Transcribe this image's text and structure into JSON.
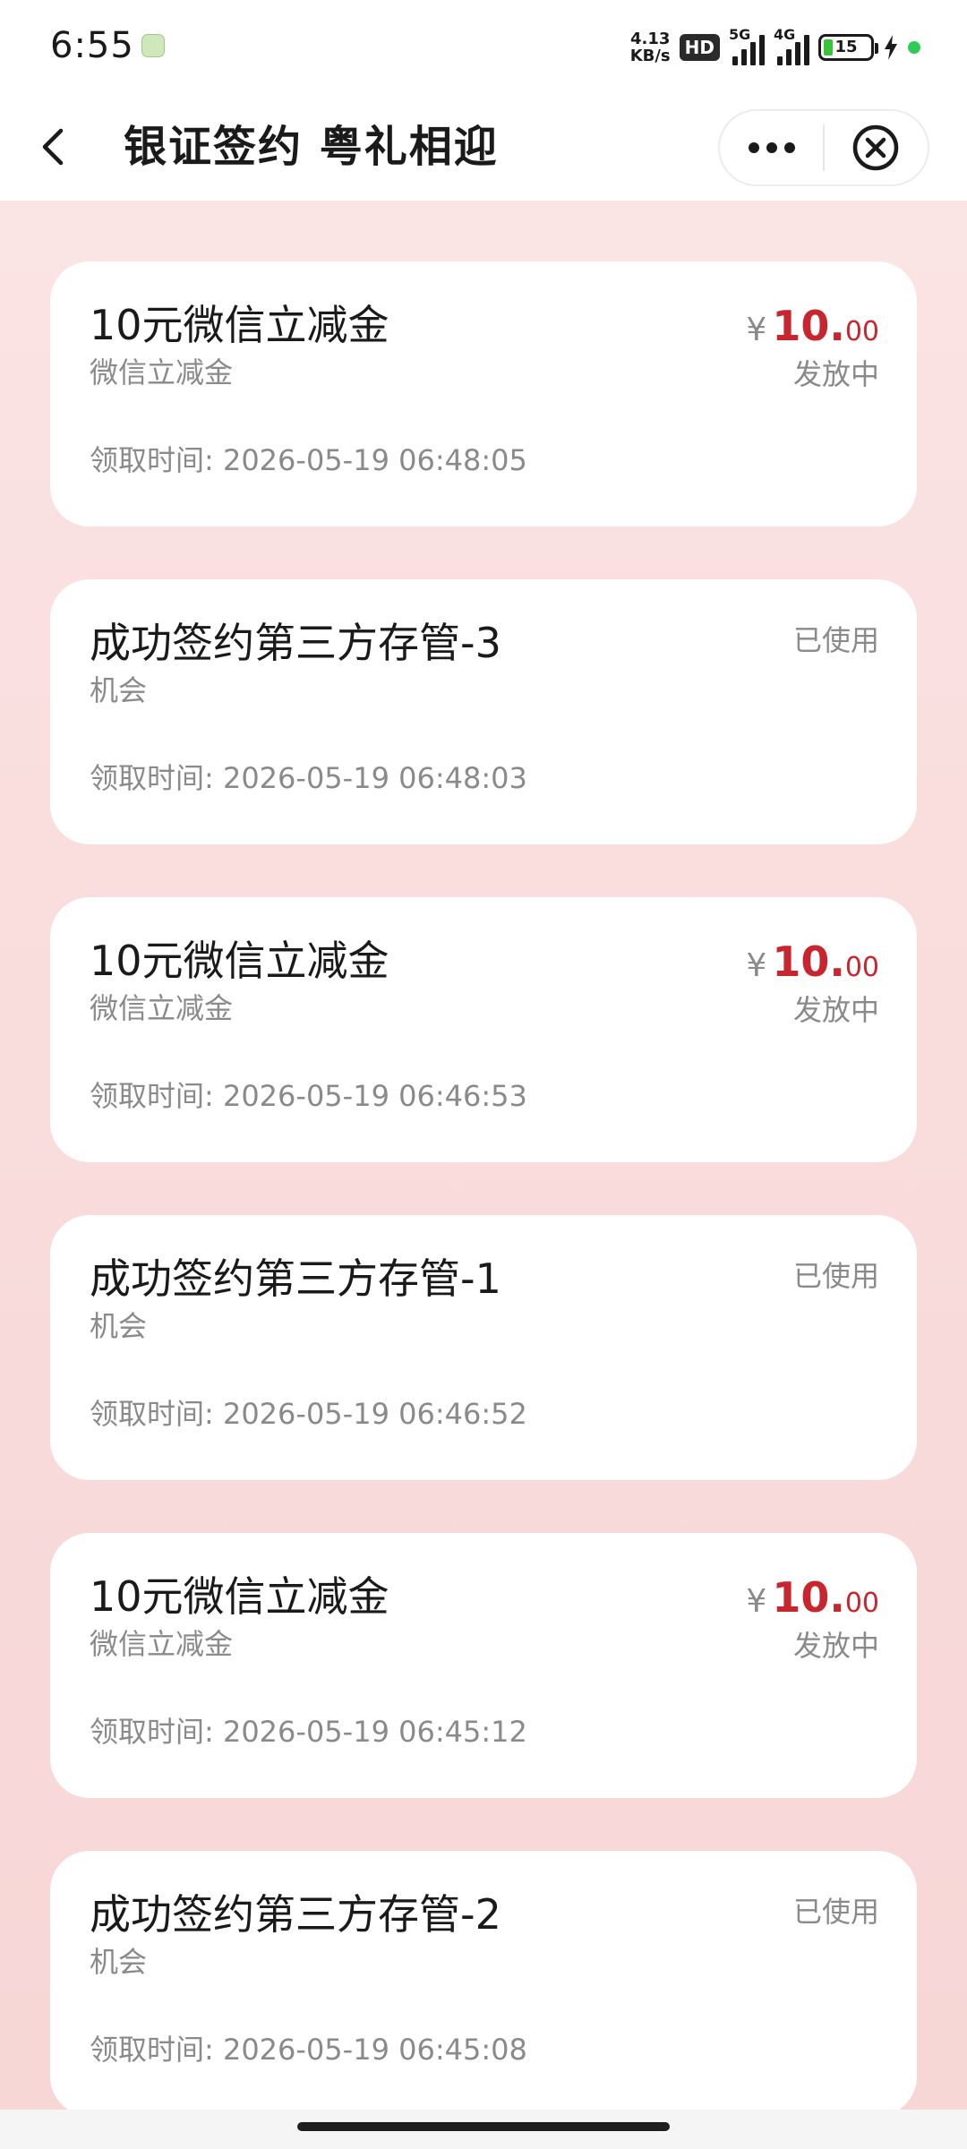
{
  "status_bar": {
    "time": "6:55",
    "net_speed_value": "4.13",
    "net_speed_unit": "KB/s",
    "hd_label": "HD",
    "signal_1_label": "5G",
    "signal_2_label": "4G",
    "battery_level": "15"
  },
  "nav": {
    "title": "银证签约 粤礼相迎",
    "more_icon": "more-dots-icon",
    "close_icon": "close-circle-icon",
    "back_icon": "chevron-left-icon"
  },
  "colors": {
    "amount_red": "#c8262e",
    "background_pink": "#fbe4e4",
    "muted_gray": "#8a8a8a"
  },
  "records": [
    {
      "title": "10元微信立减金",
      "subtitle": "微信立减金",
      "time_label": "领取时间: 2026-05-19 06:48:05",
      "currency": "¥",
      "amount_int": "10.",
      "amount_dec": "00",
      "status": "发放中"
    },
    {
      "title": "成功签约第三方存管-3",
      "subtitle": "机会",
      "time_label": "领取时间: 2026-05-19 06:48:03",
      "status": "已使用"
    },
    {
      "title": "10元微信立减金",
      "subtitle": "微信立减金",
      "time_label": "领取时间: 2026-05-19 06:46:53",
      "currency": "¥",
      "amount_int": "10.",
      "amount_dec": "00",
      "status": "发放中"
    },
    {
      "title": "成功签约第三方存管-1",
      "subtitle": "机会",
      "time_label": "领取时间: 2026-05-19 06:46:52",
      "status": "已使用"
    },
    {
      "title": "10元微信立减金",
      "subtitle": "微信立减金",
      "time_label": "领取时间: 2026-05-19 06:45:12",
      "currency": "¥",
      "amount_int": "10.",
      "amount_dec": "00",
      "status": "发放中"
    },
    {
      "title": "成功签约第三方存管-2",
      "subtitle": "机会",
      "time_label": "领取时间: 2026-05-19 06:45:08",
      "status": "已使用"
    }
  ]
}
